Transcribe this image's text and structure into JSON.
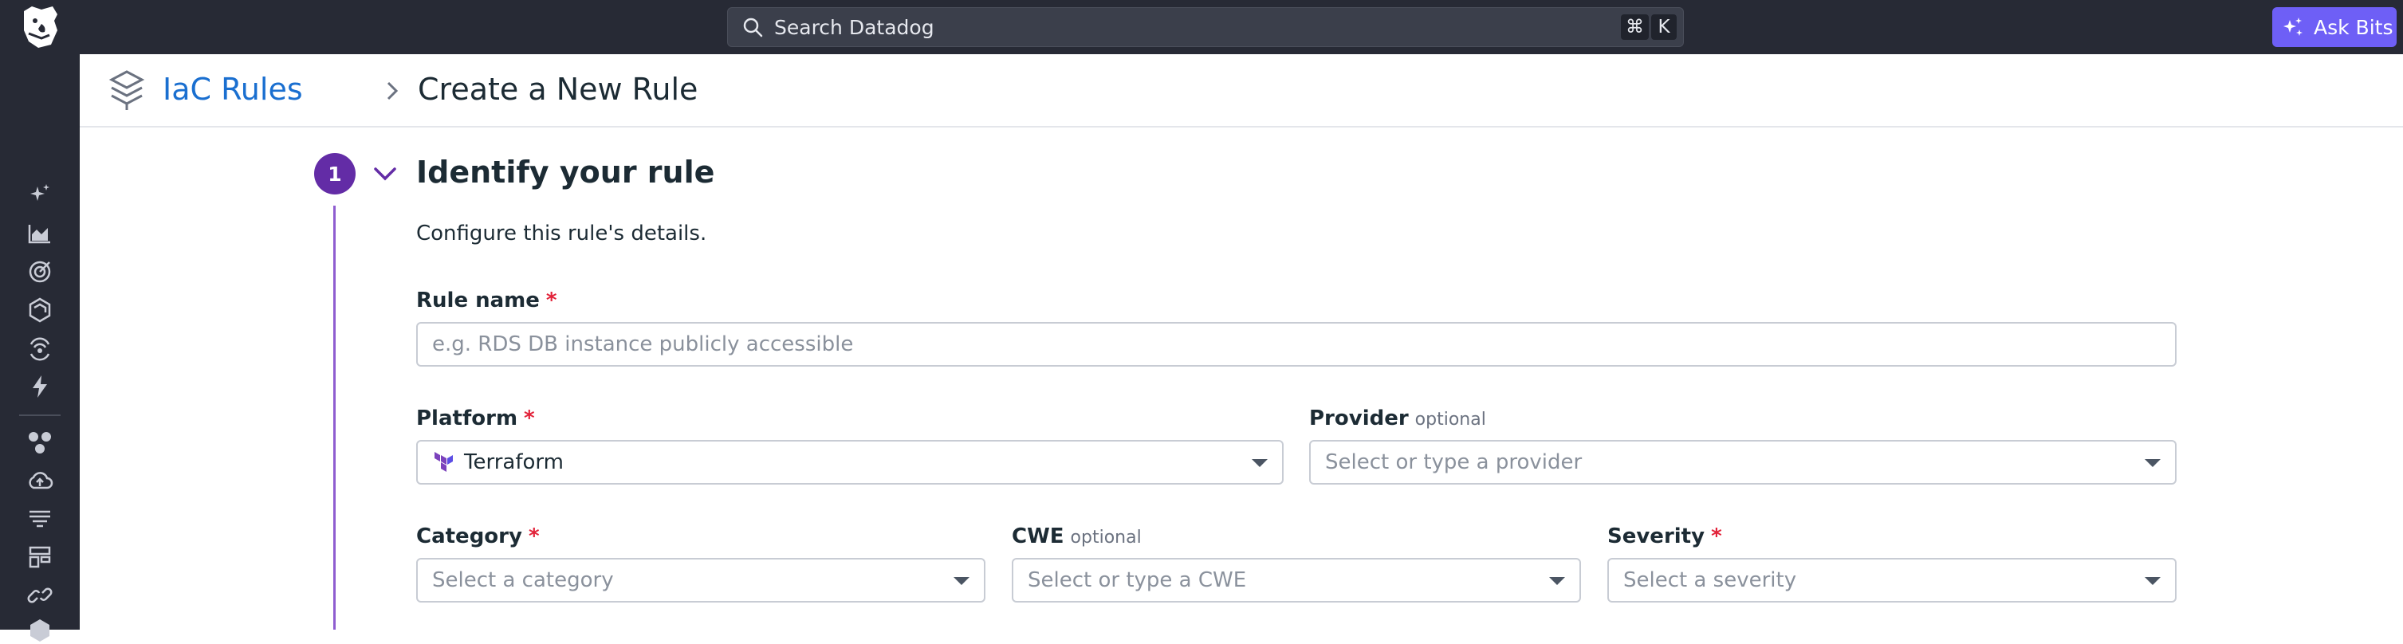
{
  "topbar": {
    "search_placeholder": "Search Datadog",
    "shortcut_cmd": "⌘",
    "shortcut_key": "K",
    "ask_label": "Ask Bits"
  },
  "breadcrumb": {
    "parent": "IaC Rules",
    "current": "Create a New Rule"
  },
  "step": {
    "number": "1",
    "title": "Identify your rule",
    "description": "Configure this rule's details."
  },
  "form": {
    "rule_name": {
      "label": "Rule name",
      "required": "*",
      "placeholder": "e.g. RDS DB instance publicly accessible"
    },
    "platform": {
      "label": "Platform",
      "required": "*",
      "value": "Terraform"
    },
    "provider": {
      "label": "Provider",
      "optional": "optional",
      "placeholder": "Select or type a provider"
    },
    "category": {
      "label": "Category",
      "required": "*",
      "placeholder": "Select a category"
    },
    "cwe": {
      "label": "CWE",
      "optional": "optional",
      "placeholder": "Select or type a CWE"
    },
    "severity": {
      "label": "Severity",
      "required": "*",
      "placeholder": "Select a severity"
    }
  },
  "colors": {
    "topbar_bg": "#272a35",
    "accent_purple": "#632ca6",
    "ask_bits_bg": "#6e5ff6",
    "link_blue": "#1a6fd0",
    "required_red": "#e2233a"
  },
  "icons": {
    "logo": "datadog-dog-logo",
    "search": "search-icon",
    "ask_bits": "sparkle-icon",
    "nav": [
      "sparkle-icon",
      "chart-area-icon",
      "target-icon",
      "hexagon-icon",
      "radar-icon",
      "bolt-icon",
      "services-icon",
      "cloud-upload-icon",
      "filter-list-icon",
      "dashboard-icon",
      "link-icon"
    ],
    "header": "layers-stack-icon",
    "platform": "terraform-icon"
  }
}
